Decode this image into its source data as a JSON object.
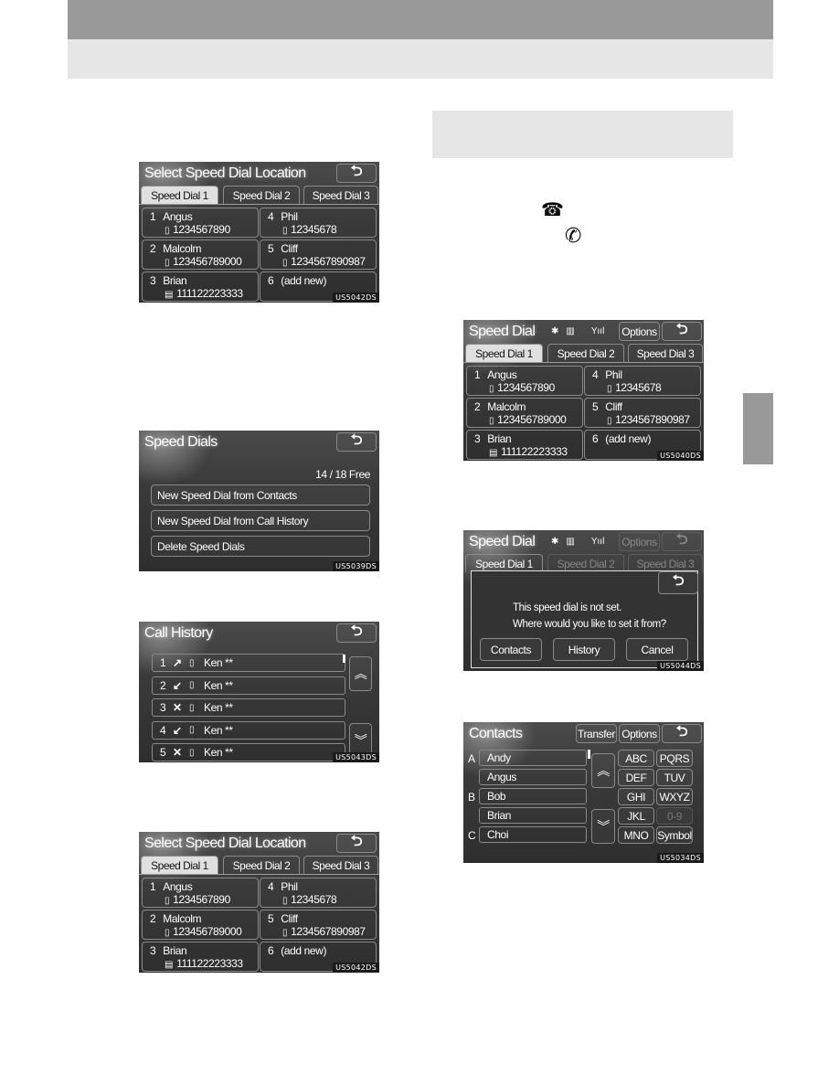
{
  "page": {
    "header_band": "",
    "section_heading": ""
  },
  "icons": {
    "phone_off_hook": "☎",
    "phone_handset": "✆"
  },
  "screens": {
    "select_location_1": {
      "title": "Select Speed Dial Location",
      "back": "⮌",
      "tabs": [
        "Speed Dial 1",
        "Speed Dial 2",
        "Speed Dial 3"
      ],
      "active_tab": 0,
      "slots": [
        {
          "num": "1",
          "name": "Angus",
          "icon": "mobile-icon",
          "number": "1234567890"
        },
        {
          "num": "4",
          "name": "Phil",
          "icon": "mobile-icon",
          "number": "12345678"
        },
        {
          "num": "2",
          "name": "Malcolm",
          "icon": "mobile-icon",
          "number": "123456789000"
        },
        {
          "num": "5",
          "name": "Cliff",
          "icon": "mobile-icon",
          "number": "1234567890987"
        },
        {
          "num": "3",
          "name": "Brian",
          "icon": "office-icon",
          "number": "111122223333"
        },
        {
          "num": "6",
          "name": "(add new)",
          "icon": "",
          "number": ""
        }
      ],
      "code": "US5042DS"
    },
    "speed_dials": {
      "title": "Speed Dials",
      "back": "⮌",
      "free_count": "14 / 18 Free",
      "buttons": [
        "New Speed Dial from Contacts",
        "New Speed Dial from Call History",
        "Delete Speed Dials"
      ],
      "code": "US5039DS"
    },
    "call_history": {
      "title": "Call History",
      "back": "⮌",
      "rows": [
        {
          "num": "1",
          "type": "outgoing",
          "type_icon": "↗",
          "name": "Ken **"
        },
        {
          "num": "2",
          "type": "incoming",
          "type_icon": "↙",
          "name": "Ken **"
        },
        {
          "num": "3",
          "type": "missed",
          "type_icon": "✕",
          "name": "Ken **"
        },
        {
          "num": "4",
          "type": "incoming",
          "type_icon": "↙",
          "name": "Ken **"
        },
        {
          "num": "5",
          "type": "missed",
          "type_icon": "✕",
          "name": "Ken **"
        }
      ],
      "scroll_up": "︽",
      "scroll_down": "︾",
      "code": "US5043DS"
    },
    "select_location_2": {
      "title": "Select Speed Dial Location",
      "back": "⮌",
      "tabs": [
        "Speed Dial 1",
        "Speed Dial 2",
        "Speed Dial 3"
      ],
      "active_tab": 0,
      "slots": [
        {
          "num": "1",
          "name": "Angus",
          "icon": "mobile-icon",
          "number": "1234567890"
        },
        {
          "num": "4",
          "name": "Phil",
          "icon": "mobile-icon",
          "number": "12345678"
        },
        {
          "num": "2",
          "name": "Malcolm",
          "icon": "mobile-icon",
          "number": "123456789000"
        },
        {
          "num": "5",
          "name": "Cliff",
          "icon": "mobile-icon",
          "number": "1234567890987"
        },
        {
          "num": "3",
          "name": "Brian",
          "icon": "office-icon",
          "number": "111122223333"
        },
        {
          "num": "6",
          "name": "(add new)",
          "icon": "",
          "number": ""
        }
      ],
      "code": "US5042DS"
    },
    "speed_dial": {
      "title": "Speed Dial",
      "options": "Options",
      "back": "⮌",
      "status": {
        "bluetooth": "✱",
        "battery": "▥",
        "signal": "Yııl"
      },
      "tabs": [
        "Speed Dial 1",
        "Speed Dial 2",
        "Speed Dial 3"
      ],
      "active_tab": 0,
      "slots": [
        {
          "num": "1",
          "name": "Angus",
          "icon": "mobile-icon",
          "number": "1234567890"
        },
        {
          "num": "4",
          "name": "Phil",
          "icon": "mobile-icon",
          "number": "12345678"
        },
        {
          "num": "2",
          "name": "Malcolm",
          "icon": "mobile-icon",
          "number": "123456789000"
        },
        {
          "num": "5",
          "name": "Cliff",
          "icon": "mobile-icon",
          "number": "1234567890987"
        },
        {
          "num": "3",
          "name": "Brian",
          "icon": "office-icon",
          "number": "111122223333"
        },
        {
          "num": "6",
          "name": "(add new)",
          "icon": "",
          "number": ""
        }
      ],
      "code": "US5040DS"
    },
    "speed_dial_popup": {
      "title": "Speed Dial",
      "options": "Options",
      "back": "⮌",
      "status": {
        "bluetooth": "✱",
        "battery": "▥",
        "signal": "Yııl"
      },
      "tabs": [
        "Speed Dial 1",
        "Speed Dial 2",
        "Speed Dial 3"
      ],
      "dialog": {
        "back": "⮌",
        "line1": "This speed dial is not set.",
        "line2": "Where would you like to set it from?",
        "buttons": [
          "Contacts",
          "History",
          "Cancel"
        ]
      },
      "code": "US5044DS"
    },
    "contacts": {
      "title": "Contacts",
      "transfer": "Transfer",
      "options": "Options",
      "back": "⮌",
      "letters": [
        "A",
        "",
        "B",
        "",
        "C"
      ],
      "names": [
        "Andy",
        "Angus",
        "Bob",
        "Brian",
        "Choi"
      ],
      "scroll_up": "︽",
      "scroll_down": "︾",
      "keys": [
        {
          "label": "ABC",
          "enabled": true
        },
        {
          "label": "PQRS",
          "enabled": true
        },
        {
          "label": "DEF",
          "enabled": true
        },
        {
          "label": "TUV",
          "enabled": true
        },
        {
          "label": "GHI",
          "enabled": true
        },
        {
          "label": "WXYZ",
          "enabled": true
        },
        {
          "label": "JKL",
          "enabled": true
        },
        {
          "label": "0-9",
          "enabled": false
        },
        {
          "label": "MNO",
          "enabled": true
        },
        {
          "label": "Symbol",
          "enabled": true
        }
      ],
      "code": "US5034DS"
    }
  }
}
